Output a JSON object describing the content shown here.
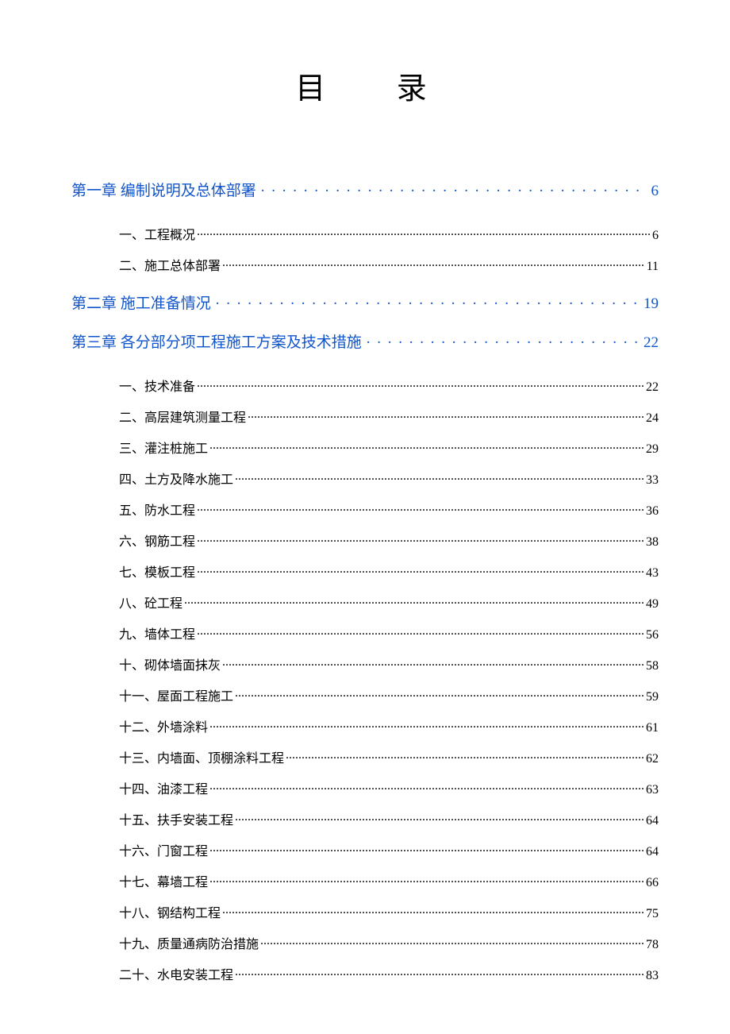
{
  "title": "目 录",
  "toc": {
    "chapters": [
      {
        "label": "第一章 编制说明及总体部署",
        "page": "6",
        "subs": [
          {
            "label": "一、工程概况",
            "page": "6"
          },
          {
            "label": "二、施工总体部署",
            "page": "11"
          }
        ]
      },
      {
        "label": "第二章 施工准备情况",
        "page": "19",
        "subs": []
      },
      {
        "label": "第三章 各分部分项工程施工方案及技术措施",
        "page": "22",
        "subs": [
          {
            "label": "一、技术准备",
            "page": "22"
          },
          {
            "label": "二、高层建筑测量工程",
            "page": "24"
          },
          {
            "label": "三、灌注桩施工",
            "page": "29"
          },
          {
            "label": "四、土方及降水施工",
            "page": "33"
          },
          {
            "label": "五、防水工程",
            "page": "36"
          },
          {
            "label": "六、钢筋工程",
            "page": "38"
          },
          {
            "label": "七、模板工程",
            "page": "43"
          },
          {
            "label": "八、砼工程",
            "page": "49"
          },
          {
            "label": "九、墙体工程",
            "page": "56"
          },
          {
            "label": "十、砌体墙面抹灰",
            "page": "58"
          },
          {
            "label": "十一、屋面工程施工",
            "page": "59"
          },
          {
            "label": "十二、外墙涂料",
            "page": "61"
          },
          {
            "label": "十三、内墙面、顶棚涂料工程",
            "page": "62"
          },
          {
            "label": "十四、油漆工程",
            "page": "63"
          },
          {
            "label": "十五、扶手安装工程",
            "page": "64"
          },
          {
            "label": "十六、门窗工程",
            "page": "64"
          },
          {
            "label": "十七、幕墙工程",
            "page": "66"
          },
          {
            "label": "十八、钢结构工程",
            "page": "75"
          },
          {
            "label": "十九、质量通病防治措施",
            "page": "78"
          },
          {
            "label": "二十、水电安装工程",
            "page": "83"
          }
        ]
      }
    ]
  }
}
